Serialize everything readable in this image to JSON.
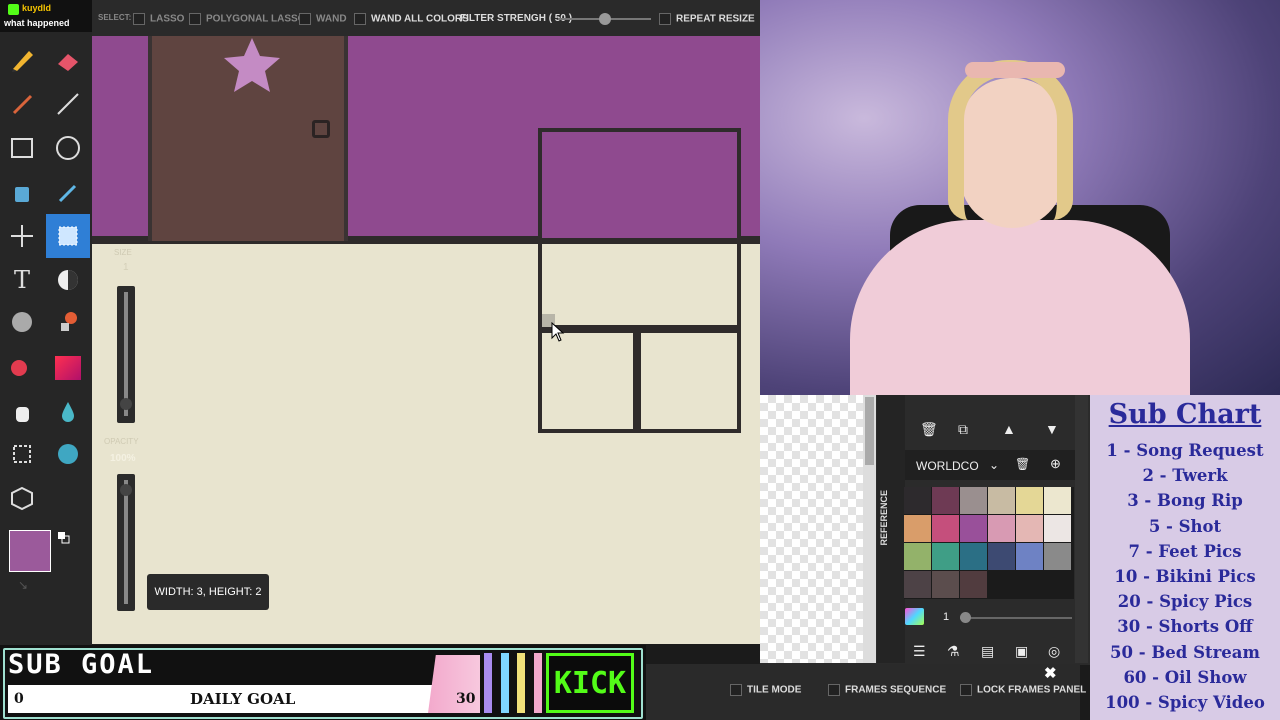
{
  "stream": {
    "kick_user": "kuydld",
    "kick_msg": "what happened"
  },
  "options_bar": {
    "select_label": "SELECT:",
    "lasso": "LASSO",
    "polygonal_lasso": "POLYGONAL LASSO",
    "wand": "WAND",
    "wand_all_colors": "WAND ALL COLORS",
    "filter_strength": "FILTER STRENGH ( 50 )",
    "filter_value": 0.5,
    "repeat_resize": "REPEAT RESIZE"
  },
  "brush": {
    "size_label": "SIZE",
    "size_value": "1",
    "opacity_label": "OPACITY",
    "opacity_value": "100%"
  },
  "selection_tooltip": "WIDTH: 3, HEIGHT: 2",
  "colors": {
    "primary": "#9b5a9b",
    "secondary": "#ffffff",
    "canvas_bg": "#e8e4cf",
    "wall": "#8f4a8f",
    "door": "#5f4440",
    "star": "#c48bc4",
    "accent": "#2f7fd6"
  },
  "palette_panel": {
    "reference_tab": "REFERENCE",
    "palette_name": "WORLDCO",
    "swatches": [
      "#2d2a2d",
      "#6e3a54",
      "#9a8f8f",
      "#c8bba3",
      "#e4d796",
      "#ece7cf",
      "#d99d6a",
      "#c54f7c",
      "#99509a",
      "#d89ab3",
      "#e4b7b4",
      "#ece6e4",
      "#93b26a",
      "#3f9e86",
      "#2b6f85",
      "#3d4a72",
      "#6e82c4",
      "#8a8a8a",
      "#4d4246",
      "#5b4d4d",
      "#513c3f"
    ],
    "layer_number": "1"
  },
  "bottom_bar": {
    "tile_mode": "TILE MODE",
    "frames_sequence": "FRAMES SEQUENCE",
    "lock_frames_panel": "LOCK FRAMES PANEL"
  },
  "sub_goal": {
    "title": "SUB GOAL",
    "current": "0",
    "label": "DAILY GOAL",
    "target": "30",
    "brand": "KICK",
    "progress": 0
  },
  "sub_chart": {
    "title": "Sub Chart",
    "items": [
      "1 - Song Request",
      "2 - Twerk",
      "3 - Bong Rip",
      "5 - Shot",
      "7 - Feet Pics",
      "10 - Bikini Pics",
      "20 - Spicy Pics",
      "30 - Shorts Off",
      "50 - Bed Stream",
      "60 - Oil Show",
      "100 - Spicy Video"
    ]
  }
}
